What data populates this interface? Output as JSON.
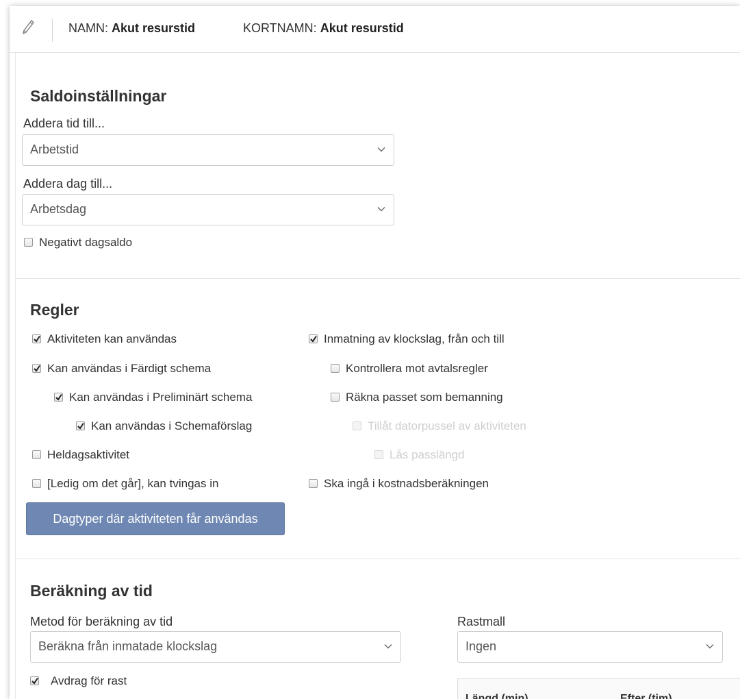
{
  "header": {
    "name_label": "NAMN:",
    "name_value": "Akut resurstid",
    "shortname_label": "KORTNAMN:",
    "shortname_value": "Akut resurstid"
  },
  "saldo": {
    "title": "Saldoinställningar",
    "add_time_label": "Addera tid till...",
    "add_time_value": "Arbetstid",
    "add_day_label": "Addera dag till...",
    "add_day_value": "Arbetsdag",
    "negative_daybalance": {
      "label": "Negativt dagsaldo",
      "checked": false
    }
  },
  "rules": {
    "title": "Regler",
    "left": [
      {
        "label": "Aktiviteten kan användas",
        "checked": true
      },
      {
        "label": "Kan användas i Färdigt schema",
        "checked": true
      },
      {
        "label": "Kan användas i Preliminärt schema",
        "checked": true
      },
      {
        "label": "Kan användas i Schemaförslag",
        "checked": true
      },
      {
        "label": "Heldagsaktivitet",
        "checked": false
      },
      {
        "label": "[Ledig om det går], kan tvingas in",
        "checked": false
      }
    ],
    "right": [
      {
        "label": "Inmatning av klockslag, från och till",
        "checked": true
      },
      {
        "label": "Kontrollera mot avtalsregler",
        "checked": false
      },
      {
        "label": "Räkna passet som bemanning",
        "checked": false
      },
      {
        "label": "Tillåt datorpussel av aktiviteten",
        "checked": false,
        "disabled": true
      },
      {
        "label": "Lås passlängd",
        "checked": false,
        "disabled": true
      },
      {
        "label": "Ska ingå i kostnadsberäkningen",
        "checked": false
      }
    ],
    "daytypes_button": "Dagtyper där aktiviteten får användas"
  },
  "calc": {
    "title": "Beräkning av tid",
    "method_label": "Metod för beräkning av tid",
    "method_value": "Beräkna från inmatade klockslag",
    "break_template_label": "Rastmall",
    "break_template_value": "Ingen",
    "break_deduction": {
      "label": "Avdrag för rast",
      "checked": true
    },
    "table_headers": [
      "Längd (min)",
      "Efter (tim)"
    ]
  },
  "colors": {
    "button_bg": "#6f88b3",
    "text": "#333333",
    "disabled_text": "#cfcfcf"
  }
}
